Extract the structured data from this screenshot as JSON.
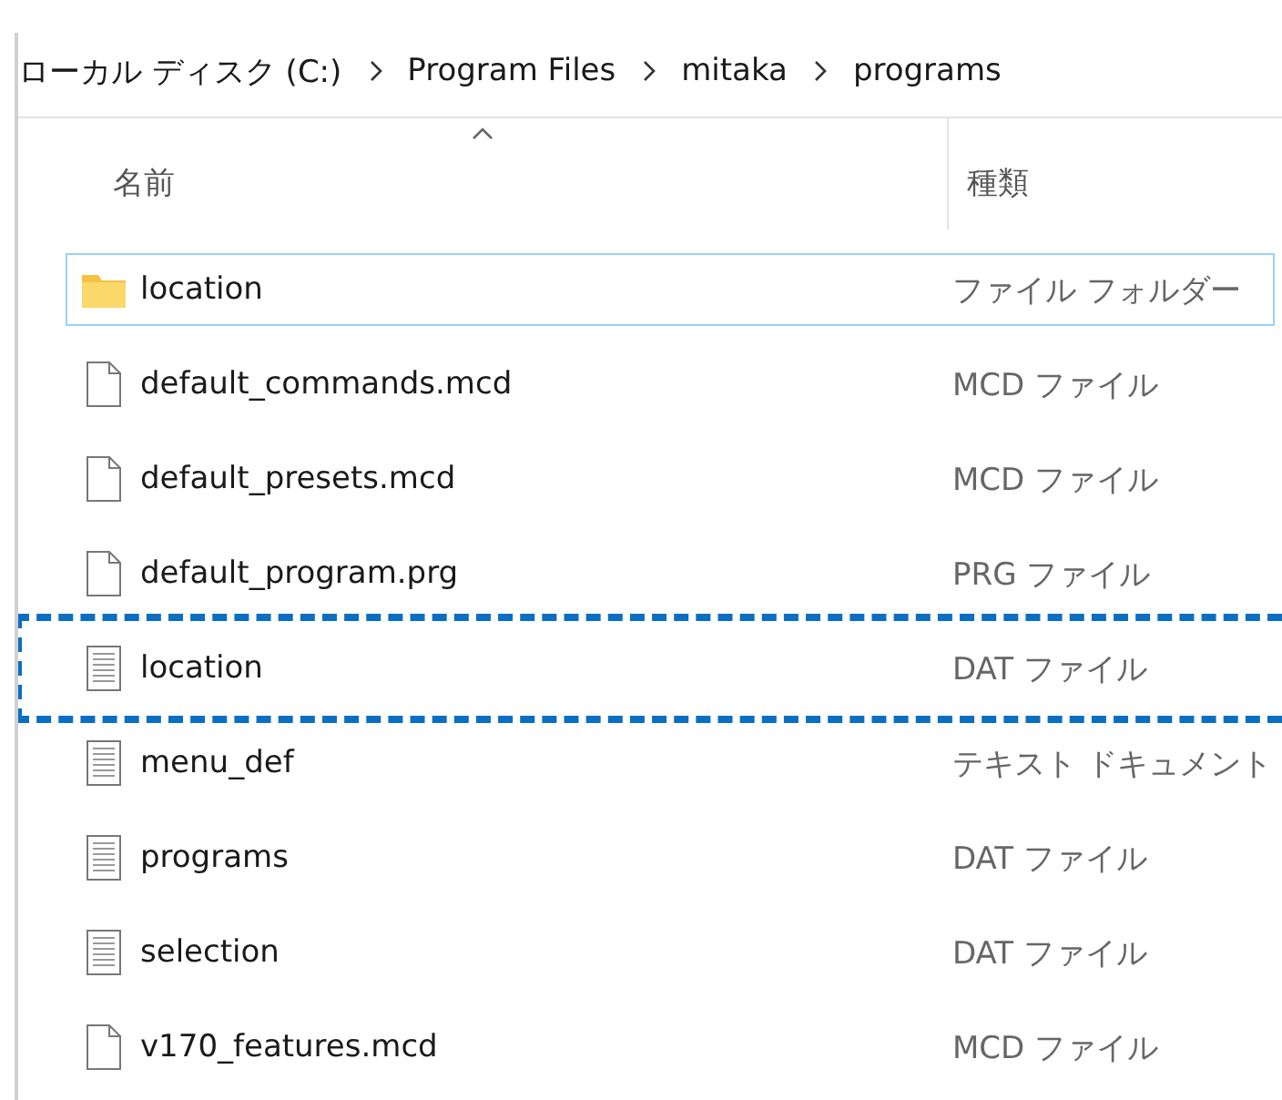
{
  "breadcrumb": [
    "ローカル ディスク (C:)",
    "Program Files",
    "mitaka",
    "programs"
  ],
  "columns": [
    {
      "label": "名前",
      "sorted": true
    },
    {
      "label": "種類",
      "sorted": false
    }
  ],
  "rows": [
    {
      "kind": "folder",
      "name": "location",
      "type": "ファイル フォルダー",
      "selected": true,
      "highlighted": false
    },
    {
      "kind": "file",
      "name": "default_commands.mcd",
      "type": "MCD ファイル",
      "selected": false,
      "highlighted": false
    },
    {
      "kind": "file",
      "name": "default_presets.mcd",
      "type": "MCD ファイル",
      "selected": false,
      "highlighted": false
    },
    {
      "kind": "file",
      "name": "default_program.prg",
      "type": "PRG ファイル",
      "selected": false,
      "highlighted": false
    },
    {
      "kind": "text",
      "name": "location",
      "type": "DAT ファイル",
      "selected": false,
      "highlighted": true
    },
    {
      "kind": "text",
      "name": "menu_def",
      "type": "テキスト ドキュメント",
      "selected": false,
      "highlighted": false
    },
    {
      "kind": "text",
      "name": "programs",
      "type": "DAT ファイル",
      "selected": false,
      "highlighted": false
    },
    {
      "kind": "text",
      "name": "selection",
      "type": "DAT ファイル",
      "selected": false,
      "highlighted": false
    },
    {
      "kind": "file",
      "name": "v170_features.mcd",
      "type": "MCD ファイル",
      "selected": false,
      "highlighted": false
    }
  ]
}
